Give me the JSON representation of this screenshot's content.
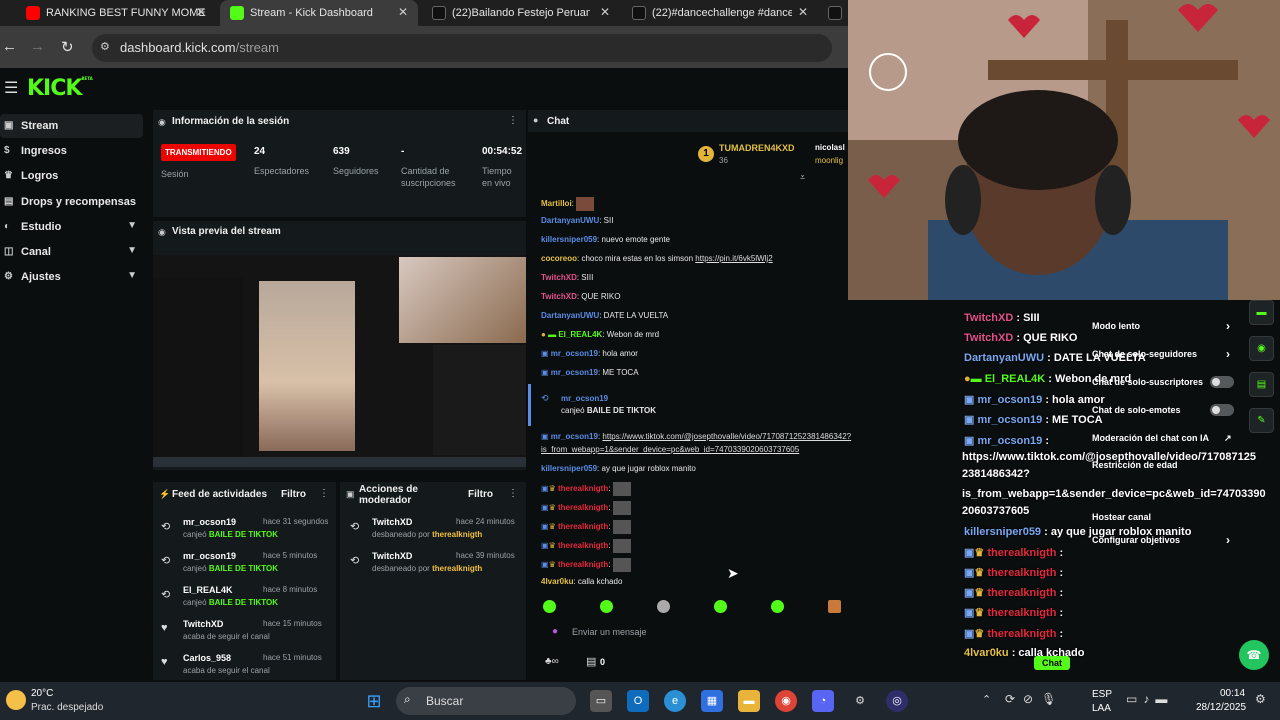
{
  "browser": {
    "tabs": [
      {
        "title": "RANKING BEST FUNNY MOME",
        "icon": "youtube-icon",
        "color": "#ff0000"
      },
      {
        "title": "Stream - Kick Dashboard",
        "icon": "kick-icon",
        "color": "#53fc18"
      },
      {
        "title": "(22)Bailando Festejo Peruano: I",
        "icon": "tiktok-icon",
        "color": "#ffffff"
      },
      {
        "title": "(22)#dancechallenge #dancetre",
        "icon": "tiktok-icon",
        "color": "#ffffff"
      }
    ],
    "url_host": "dashboard.kick.com",
    "url_path": "/stream"
  },
  "kick": {
    "logo": "KICK",
    "logo_sup": "BETA",
    "accent": "#53fc18"
  },
  "sidebar": {
    "items": [
      {
        "label": "Stream"
      },
      {
        "label": "Ingresos"
      },
      {
        "label": "Logros"
      },
      {
        "label": "Drops y recompensas"
      },
      {
        "label": "Estudio"
      },
      {
        "label": "Canal"
      },
      {
        "label": "Ajustes"
      }
    ]
  },
  "session": {
    "title": "Información de la sesión",
    "live_badge": "TRANSMITIENDO",
    "session_label": "Sesión",
    "viewers": "24",
    "viewers_label": "Espectadores",
    "followers": "639",
    "followers_label": "Seguidores",
    "subs": "-",
    "subs_label": "Cantidad de suscripciones",
    "time": "00:54:52",
    "time_label": "Tiempo en vivo"
  },
  "preview": {
    "title": "Vista previa del stream"
  },
  "feed": {
    "title": "Feed de actividades",
    "filter": "Filtro",
    "items": [
      {
        "name": "mr_ocson19",
        "time": "hace 31 segundos",
        "action": "canjeó",
        "reward": "BAILE DE TIKTOK"
      },
      {
        "name": "mr_ocson19",
        "time": "hace 5 minutos",
        "action": "canjeó",
        "reward": "BAILE DE TIKTOK"
      },
      {
        "name": "El_REAL4K",
        "time": "hace 8 minutos",
        "action": "canjeó",
        "reward": "BAILE DE TIKTOK"
      },
      {
        "name": "TwitchXD",
        "time": "hace 15 minutos",
        "action": "acaba de seguir el canal",
        "reward": ""
      },
      {
        "name": "Carlos_958",
        "time": "hace 51 minutos",
        "action": "acaba de seguir el canal",
        "reward": ""
      }
    ]
  },
  "modactions": {
    "title": "Acciones de moderador",
    "filter": "Filtro",
    "items": [
      {
        "name": "TwitchXD",
        "time": "hace 24 minutos",
        "action": "desbaneado por",
        "by": "therealknigth"
      },
      {
        "name": "TwitchXD",
        "time": "hace 39 minutos",
        "action": "desbaneado por",
        "by": "therealknigth"
      }
    ]
  },
  "chat": {
    "title": "Chat",
    "pinned_user": "TUMADREN4KXD",
    "pinned_count": "36",
    "pinned_user2": "nicolasl",
    "pinned_user3": "moonlig",
    "messages": [
      {
        "user": "Martilloi",
        "text": "",
        "color": "#e2c044"
      },
      {
        "user": "DartanyanUWU",
        "text": ": SII",
        "color": "#5b8de5"
      },
      {
        "user": "killersniper059",
        "text": ": nuevo emote gente",
        "color": "#5b8de5"
      },
      {
        "user": "cocoreoo",
        "text": ": choco mira estas en los simson ",
        "link": "https://pin.it/6vk5lWlj2",
        "color": "#e2c044"
      },
      {
        "user": "TwitchXD",
        "text": ": SIII",
        "color": "#e5508c"
      },
      {
        "user": "TwitchXD",
        "text": ": QUE RIKO",
        "color": "#e5508c"
      },
      {
        "user": "DartanyanUWU",
        "text": ": DATE LA VUELTA",
        "color": "#5b8de5"
      },
      {
        "user": "El_REAL4K",
        "text": ": Webon de mrd",
        "color": "#53fc18"
      },
      {
        "user": "mr_ocson19",
        "text": ": hola amor",
        "color": "#5b8de5"
      },
      {
        "user": "mr_ocson19",
        "text": ": ME TOCA",
        "color": "#5b8de5"
      }
    ],
    "redeem_user": "mr_ocson19",
    "redeem_text": "canjeó",
    "redeem_reward": "BAILE DE TIKTOK",
    "long_user": "mr_ocson19",
    "long_link1": "https://www.tiktok.com/@josepthovalle/video/7170871252381486342?",
    "long_link2": "is_from_webapp=1&sender_device=pc&web_id=7470339020603737605",
    "msg_ks": {
      "user": "killersniper059",
      "text": ": ay que jugar roblox manito"
    },
    "knight_user": "therealknigth",
    "last_user": "4lvar0ku",
    "last_text": ": calla kchado",
    "input_placeholder": "Enviar un mensaje",
    "points": "0"
  },
  "overlay": {
    "lines": [
      {
        "user": "TwitchXD",
        "text": " : SIII",
        "color": "#e5508c"
      },
      {
        "user": "TwitchXD",
        "text": " : QUE RIKO",
        "color": "#e5508c"
      },
      {
        "user": "DartanyanUWU",
        "text": " : DATE LA VUELTA",
        "color": "#7aa7f0"
      },
      {
        "user": "El_REAL4K",
        "text": " : Webon de mrd",
        "color": "#53fc18"
      },
      {
        "user": "mr_ocson19",
        "text": " : hola amor",
        "color": "#7aa7f0"
      },
      {
        "user": "mr_ocson19",
        "text": " : ME TOCA",
        "color": "#7aa7f0"
      },
      {
        "user": "mr_ocson19",
        "text": " :",
        "color": "#7aa7f0"
      }
    ],
    "link1": "https://www.tiktok.com/@josepthovalle/video/717087125",
    "link2": "2381486342?",
    "link3": "is_from_webapp=1&sender_device=pc&web_id=74703390",
    "link4": "20603737605",
    "ks_user": "killersniper059",
    "ks_text": " : ay que jugar roblox manito",
    "knight": "therealknigth",
    "last_user": "4lvar0ku",
    "last_text": " : calla kchado",
    "chat_btn": "Chat",
    "menu": [
      "Modo lento",
      "Chat de solo-seguidores",
      "Chat de solo-suscriptores",
      "Chat de solo-emotes",
      "Moderación del chat con IA",
      "Restricción de edad",
      "Hostear canal",
      "Configurar objetivos"
    ]
  },
  "taskbar": {
    "weather_temp": "20°C",
    "weather_desc": "Prac. despejado",
    "search": "Buscar",
    "lang1": "ESP",
    "lang2": "LAA",
    "time": "00:14",
    "date": "28/12/2025"
  }
}
